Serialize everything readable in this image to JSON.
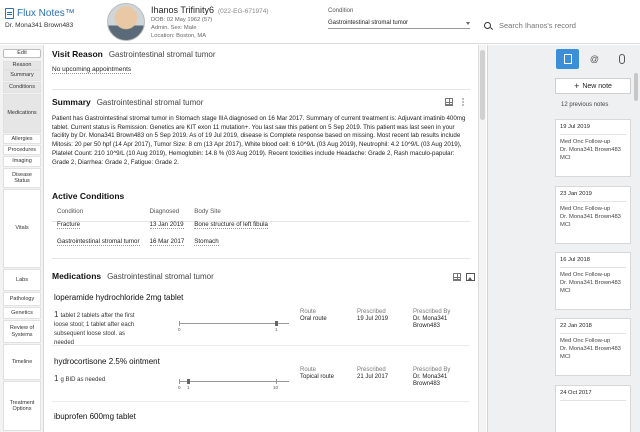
{
  "app": {
    "brand": "Flux Notes™",
    "user": "Dr. Mona341 Brown483"
  },
  "patient": {
    "name": "Ihanos Trifinity6",
    "id": "(022-EG-671974)",
    "dob": "DOB: 02 May 1962 (57)",
    "admin": "Admin. Sex: Male",
    "location": "Location: Boston, MA"
  },
  "condition": {
    "label": "Condition",
    "selected": "Gastrointestinal stromal tumor"
  },
  "search": {
    "placeholder": "Search Ihanos's record"
  },
  "nav": {
    "edit": "Edit",
    "items": [
      "Reason",
      "Summary",
      "Conditions",
      "Medications",
      "Allergies",
      "Procedures",
      "Imaging",
      "Disease Status",
      "Vitals",
      "Labs",
      "Pathology",
      "Genetics",
      "Review of Systems",
      "Timeline",
      "Treatment Options"
    ]
  },
  "visit": {
    "title": "Visit Reason",
    "condition": "Gastrointestinal stromal tumor",
    "appointments": "No upcoming appointments"
  },
  "summary": {
    "title": "Summary",
    "condition": "Gastrointestinal stromal tumor",
    "text": "Patient has Gastrointestinal stromal tumor in Stomach stage IIIA diagnosed on 16 Mar 2017. Summary of current treatment is: Adjuvant imatinib 400mg tablet. Current status is Remission. Genetics are KIT exon 11 mutation+. You last saw this patient on 5 Sep 2019. This patient was last seen in your facility by Dr. Mona341 Brown483 on 5 Sep 2019. As of 19 Jul 2019, disease is Complete response based on missing. Most recent lab results include Mitosis: 20 per 50 hpf (14 Apr 2017), Tumor Size: 8 cm (13 Apr 2017), White blood cell: 6 10^9/L (03 Aug 2019), Neutrophil: 4.2 10^9/L (03 Aug 2019), Platelet Count: 210 10^9/L (10 Aug 2019), Hemoglobin: 14.8 % (03 Aug 2019). Recent toxicities include Headache: Grade 2, Rash maculo-papular: Grade 2, Diarrhea: Grade 2, Fatigue: Grade 2."
  },
  "conditions": {
    "title": "Active Conditions",
    "headers": [
      "Condition",
      "Diagnosed",
      "Body Site"
    ],
    "rows": [
      [
        "Fracture",
        "13 Jan 2019",
        "Bone structure of left fibula"
      ],
      [
        "Gastrointestinal stromal tumor",
        "16 Mar 2017",
        "Stomach"
      ]
    ]
  },
  "medications": {
    "title": "Medications",
    "condition": "Gastrointestinal stromal tumor",
    "route_label": "Route",
    "prescribed_label": "Prescribed",
    "prescribed_by_label": "Prescribed By",
    "items": [
      {
        "name": "loperamide hydrochloride 2mg tablet",
        "qty": "1",
        "dose": "tablet 2 tablets after the first loose stool; 1 tablet after each subsequent loose stool. as needed",
        "route": "Oral route",
        "date": "19 Jul 2019",
        "by": "Dr. Mona341 Brown483",
        "range": [
          "0",
          "1"
        ]
      },
      {
        "name": "hydrocortisone 2.5% ointment",
        "qty": "1",
        "dose": "g BID as needed",
        "route": "Topical route",
        "date": "21 Jul 2017",
        "by": "Dr. Mona341 Brown483",
        "range": [
          "0",
          "1",
          "10"
        ]
      },
      {
        "name": "ibuprofen 600mg tablet"
      }
    ]
  },
  "notes_panel": {
    "new_note": "New note",
    "previous": "12 previous notes",
    "notes": [
      {
        "date": "19 Jul 2019",
        "type": "Med Onc Follow-up",
        "author": "Dr. Mona341 Brown483",
        "org": "MCI"
      },
      {
        "date": "23 Jan 2019",
        "type": "Med Onc Follow-up",
        "author": "Dr. Mona341 Brown483",
        "org": "MCI"
      },
      {
        "date": "16 Jul 2018",
        "type": "Med Onc Follow-up",
        "author": "Dr. Mona341 Brown483",
        "org": "MCI"
      },
      {
        "date": "22 Jan 2018",
        "type": "Med Onc Follow-up",
        "author": "Dr. Mona341 Brown483",
        "org": "MCI"
      },
      {
        "date": "24 Oct 2017",
        "type": "",
        "author": "",
        "org": ""
      }
    ]
  },
  "colors": {
    "accent": "#3a8fd8",
    "brand": "#2a6fb3"
  }
}
